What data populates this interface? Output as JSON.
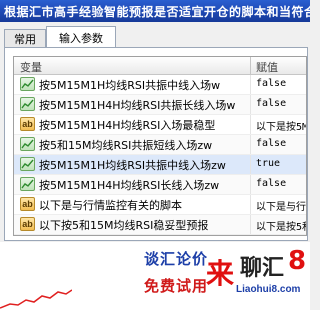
{
  "banner": {
    "text": "根据汇市高手经验智能预报是否适宜开仓的脚本和当符合对"
  },
  "tabs": [
    {
      "label": "常用",
      "active": false
    },
    {
      "label": "输入参数",
      "active": true
    }
  ],
  "table": {
    "headers": {
      "variable": "变量",
      "value": "赋值"
    },
    "rows": [
      {
        "icon": "chart-icon",
        "name": "按5M15M1H均线RSI共振中线入场w",
        "value": "false",
        "selected": false
      },
      {
        "icon": "chart-icon",
        "name": "按5M15M1H4H均线RSI共振长线入场w",
        "value": "false",
        "selected": false
      },
      {
        "icon": "ab-icon",
        "icon_text": "ab",
        "name": "按5M15M1H4H均线RSI入场最稳型",
        "value": "以下是按5M15",
        "selected": false
      },
      {
        "icon": "chart-icon",
        "name": "按5和15M均线RSI共振短线入场zw",
        "value": "false",
        "selected": false
      },
      {
        "icon": "chart-icon",
        "name": "按5M15M1H均线RSI共振中线入场zw",
        "value": "true",
        "selected": true
      },
      {
        "icon": "chart-icon",
        "name": "按5M15M1H4H均线RSI长线入场zw",
        "value": "false",
        "selected": false
      },
      {
        "icon": "ab-icon",
        "icon_text": "ab",
        "name": "以下是与行情监控有关的脚本",
        "value": "以下是与行情",
        "selected": false
      },
      {
        "icon": "ab-icon",
        "icon_text": "ab",
        "name": "以下按5和15M均线RSI稳妥型预报",
        "value": "以下是按5和1",
        "selected": false
      }
    ]
  },
  "ad": {
    "line1": "谈汇论价",
    "line2": "免费试用",
    "mark": "来",
    "brand": "聊汇",
    "brand_digit": "8",
    "url": "Liaohui8.com"
  }
}
